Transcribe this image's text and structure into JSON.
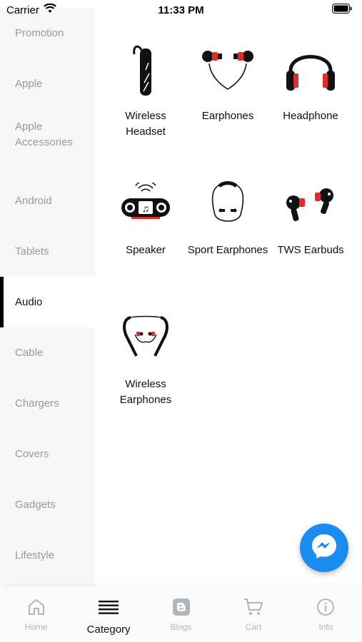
{
  "status_bar": {
    "carrier": "Carrier",
    "time": "11:33 PM"
  },
  "sidebar": {
    "items": [
      {
        "label": "Promotion"
      },
      {
        "label": "Apple"
      },
      {
        "label": "Apple Accessories"
      },
      {
        "label": "Android"
      },
      {
        "label": "Tablets"
      },
      {
        "label": "Audio",
        "active": true
      },
      {
        "label": "Cable"
      },
      {
        "label": "Chargers"
      },
      {
        "label": "Covers"
      },
      {
        "label": "Gadgets"
      },
      {
        "label": "Lifestyle"
      }
    ]
  },
  "categories": [
    {
      "label": "Wireless Headset",
      "icon": "wireless-headset-icon"
    },
    {
      "label": "Earphones",
      "icon": "earphones-icon"
    },
    {
      "label": "Headphone",
      "icon": "headphone-icon"
    },
    {
      "label": "Speaker",
      "icon": "speaker-icon"
    },
    {
      "label": "Sport Earphones",
      "icon": "sport-earphones-icon"
    },
    {
      "label": "TWS Earbuds",
      "icon": "tws-earbuds-icon"
    },
    {
      "label": "Wireless Earphones",
      "icon": "wireless-earphones-icon"
    }
  ],
  "bottom_nav": {
    "items": [
      {
        "label": "Home",
        "icon": "home-icon"
      },
      {
        "label": "Category",
        "icon": "menu-icon",
        "active": true
      },
      {
        "label": "Blogs",
        "icon": "blogger-icon"
      },
      {
        "label": "Cart",
        "icon": "cart-icon"
      },
      {
        "label": "Info",
        "icon": "info-icon"
      }
    ]
  },
  "colors": {
    "accent_red": "#e32b2b",
    "messenger_blue": "#1a8cf0",
    "inactive_gray": "#9a9a9a"
  }
}
